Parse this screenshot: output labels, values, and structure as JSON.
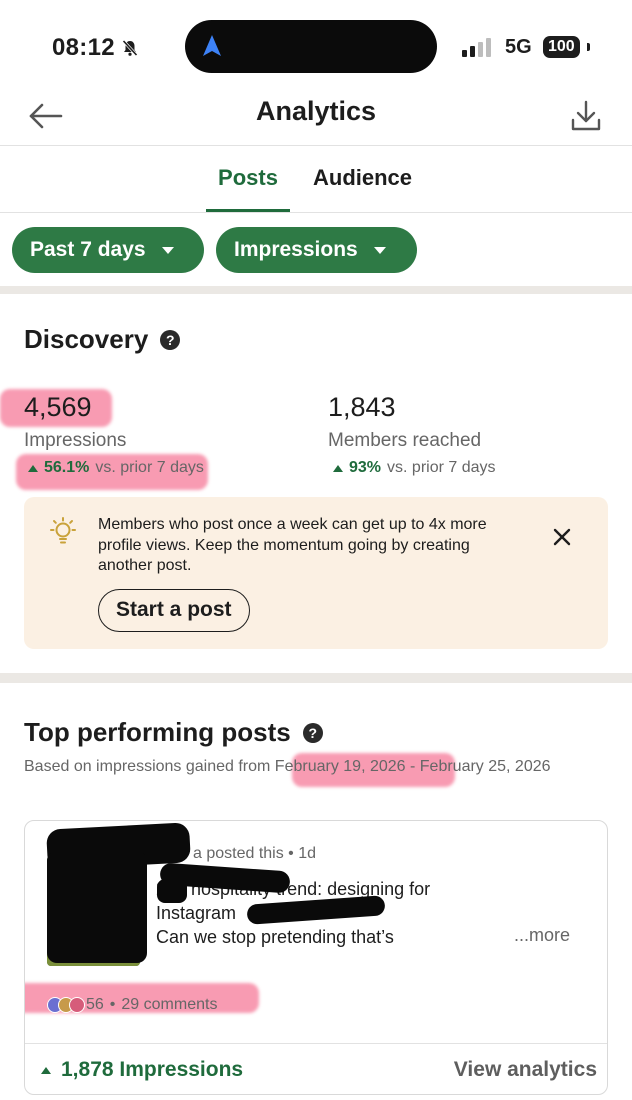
{
  "status_bar": {
    "time": "08:12",
    "network": "5G",
    "battery": "100"
  },
  "header": {
    "title": "Analytics"
  },
  "tabs": [
    {
      "label": "Posts",
      "active": true
    },
    {
      "label": "Audience",
      "active": false
    }
  ],
  "filters": {
    "range": "Past 7 days",
    "metric": "Impressions"
  },
  "discovery": {
    "title": "Discovery",
    "help_icon": "?",
    "metrics": [
      {
        "value": "4,569",
        "label": "Impressions",
        "change_pct": "56.1%",
        "change_text": "vs. prior 7 days"
      },
      {
        "value": "1,843",
        "label": "Members reached",
        "change_pct": "93%",
        "change_text": "vs. prior 7 days"
      }
    ],
    "tip": {
      "text": "Members who post once a week can get up to 4x more profile views. Keep the momentum going by creating another post.",
      "button": "Start a post"
    }
  },
  "top_posts": {
    "title": "Top performing posts",
    "help_icon": "?",
    "based_on": "Based on impressions gained from February 19, 2026 - February 25, 2026",
    "post": {
      "meta": "a posted this • 1d",
      "text_line1": "202 hospitality trend: designing for",
      "text_line2": "Instagram",
      "text_line3": "Can we stop pretending that’s",
      "more": "...more",
      "reactions": "56",
      "comments": "29 comments",
      "impressions": "1,878 Impressions",
      "view_analytics": "View analytics"
    }
  },
  "colors": {
    "accent_green": "#1f6b3c",
    "pill_green": "#2e7a45",
    "tip_background": "#fbf0e3",
    "highlight_pink": "#f45e82"
  },
  "icons": {
    "back": "back-arrow-icon",
    "download": "download-icon",
    "mute": "bell-slash-icon",
    "navigation": "location-arrow-icon",
    "tip": "lightbulb-icon",
    "close": "close-icon"
  }
}
